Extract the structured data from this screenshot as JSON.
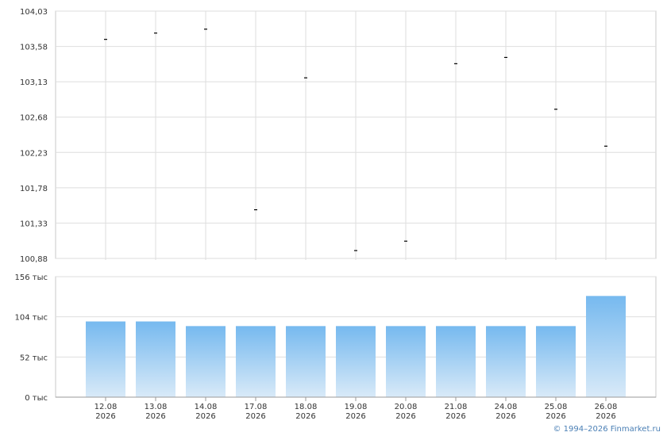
{
  "chart_data": [
    {
      "type": "scatter",
      "marker": "dash",
      "categories": [
        "12.08\n2026",
        "13.08\n2026",
        "14.08\n2026",
        "17.08\n2026",
        "18.08\n2026",
        "19.08\n2026",
        "20.08\n2026",
        "21.08\n2026",
        "24.08\n2026",
        "25.08\n2026",
        "26.08\n2026"
      ],
      "values": [
        103.67,
        103.75,
        103.8,
        101.5,
        103.18,
        100.98,
        101.1,
        103.36,
        103.44,
        102.78,
        102.31
      ],
      "ylim": [
        100.88,
        104.03
      ],
      "yticks": [
        "104,03",
        "103,58",
        "103,13",
        "102,68",
        "102,23",
        "101,78",
        "101,33",
        "100,88"
      ],
      "grid": true
    },
    {
      "type": "bar",
      "categories": [
        "12.08\n2026",
        "13.08\n2026",
        "14.08\n2026",
        "17.08\n2026",
        "18.08\n2026",
        "19.08\n2026",
        "20.08\n2026",
        "21.08\n2026",
        "24.08\n2026",
        "25.08\n2026",
        "26.08\n2026"
      ],
      "values": [
        98000,
        98000,
        92000,
        92000,
        92000,
        92000,
        92000,
        92000,
        92000,
        92000,
        131000
      ],
      "ylim": [
        0,
        156000
      ],
      "yticks": [
        "156 тыс",
        "104 тыс",
        "52 тыс",
        "0 тыс"
      ],
      "grid": true,
      "colors": {
        "bar_top": "#76b9ef",
        "bar_bottom": "#d9eaf8"
      }
    }
  ],
  "footer": {
    "copyright": "© 1994–2026 Finmarket.ru"
  }
}
